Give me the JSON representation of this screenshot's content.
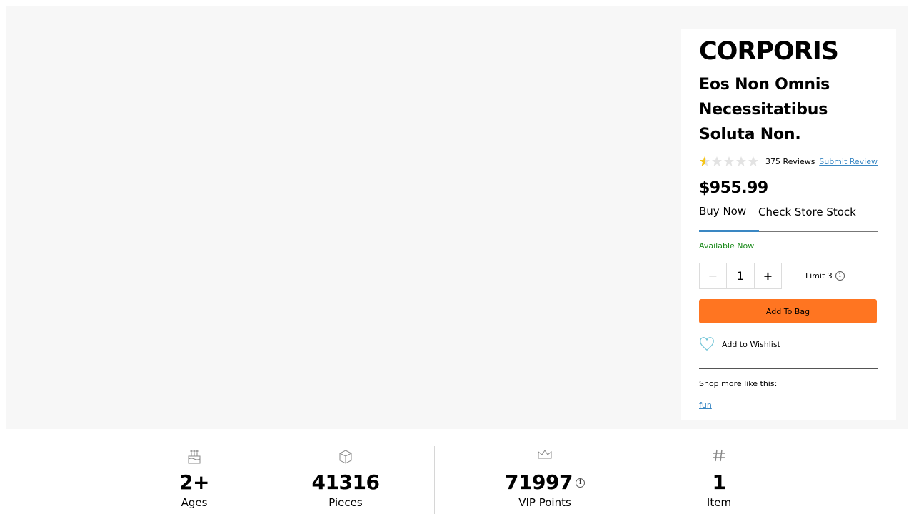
{
  "product": {
    "brand": "CORPORIS",
    "title": "Eos Non Omnis Necessitatibus Soluta Non.",
    "rating": {
      "value": 0.5,
      "max": 5
    },
    "reviews_count": "375 Reviews",
    "submit_review": "Submit Review",
    "price": "$955.99",
    "tabs": [
      "Buy Now",
      "Check Store Stock"
    ],
    "availability": "Available Now",
    "quantity": {
      "minus": "−",
      "value": "1",
      "plus": "+",
      "limit": "Limit 3"
    },
    "add_to_bag": "Add To Bag",
    "wishlist": "Add to Wishlist",
    "shop_more": "Shop more like this:",
    "tag": "fun"
  },
  "stats": [
    {
      "icon": "cake-icon",
      "value": "2+",
      "label": "Ages"
    },
    {
      "icon": "brick-icon",
      "value": "41316",
      "label": "Pieces"
    },
    {
      "icon": "crown-icon",
      "value": "71997",
      "label": "VIP Points"
    },
    {
      "icon": "hash-icon",
      "value": "1",
      "label": "Item"
    }
  ],
  "colors": {
    "accent": "#ff7521",
    "link": "#3a87c3",
    "available": "#1a8a1a",
    "star": "#f5c518"
  }
}
